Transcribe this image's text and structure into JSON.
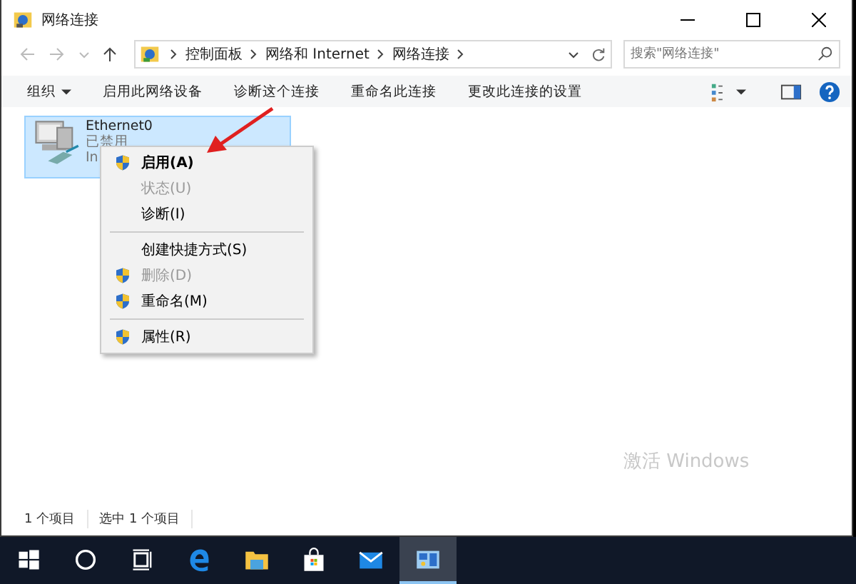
{
  "window": {
    "title": "网络连接"
  },
  "address_bar": {
    "path": [
      "控制面板",
      "网络和 Internet",
      "网络连接"
    ],
    "search_placeholder": "搜索\"网络连接\""
  },
  "command_bar": {
    "items": [
      {
        "label": "组织",
        "kind": "dropdown"
      },
      {
        "label": "启用此网络设备",
        "kind": "plain"
      },
      {
        "label": "诊断这个连接",
        "kind": "plain"
      },
      {
        "label": "重命名此连接",
        "kind": "plain"
      },
      {
        "label": "更改此连接的设置",
        "kind": "plain"
      }
    ]
  },
  "connections": [
    {
      "name": "Ethernet0",
      "status": "已禁用",
      "device": "In",
      "selected": true
    }
  ],
  "context_menu": {
    "items": [
      {
        "label": "启用(A)",
        "kind": "item",
        "shield": true,
        "disabled": false,
        "default": true
      },
      {
        "label": "状态(U)",
        "kind": "item",
        "shield": false,
        "disabled": true,
        "default": false
      },
      {
        "label": "诊断(I)",
        "kind": "item",
        "shield": false,
        "disabled": false,
        "default": false
      },
      {
        "kind": "separator"
      },
      {
        "label": "创建快捷方式(S)",
        "kind": "item",
        "shield": false,
        "disabled": false,
        "default": false
      },
      {
        "label": "删除(D)",
        "kind": "item",
        "shield": true,
        "disabled": true,
        "default": false
      },
      {
        "label": "重命名(M)",
        "kind": "item",
        "shield": true,
        "disabled": false,
        "default": false
      },
      {
        "kind": "separator"
      },
      {
        "label": "属性(R)",
        "kind": "item",
        "shield": true,
        "disabled": false,
        "default": false
      }
    ]
  },
  "activation_notice": "激活 Windows",
  "status_bar": [
    "1 个项目",
    "选中 1 个项目"
  ],
  "taskbar": {
    "items": [
      {
        "kind": "start"
      },
      {
        "kind": "search"
      },
      {
        "kind": "taskview"
      },
      {
        "kind": "edge"
      },
      {
        "kind": "explorer"
      },
      {
        "kind": "store"
      },
      {
        "kind": "mail"
      },
      {
        "kind": "network",
        "selected": true
      }
    ]
  }
}
